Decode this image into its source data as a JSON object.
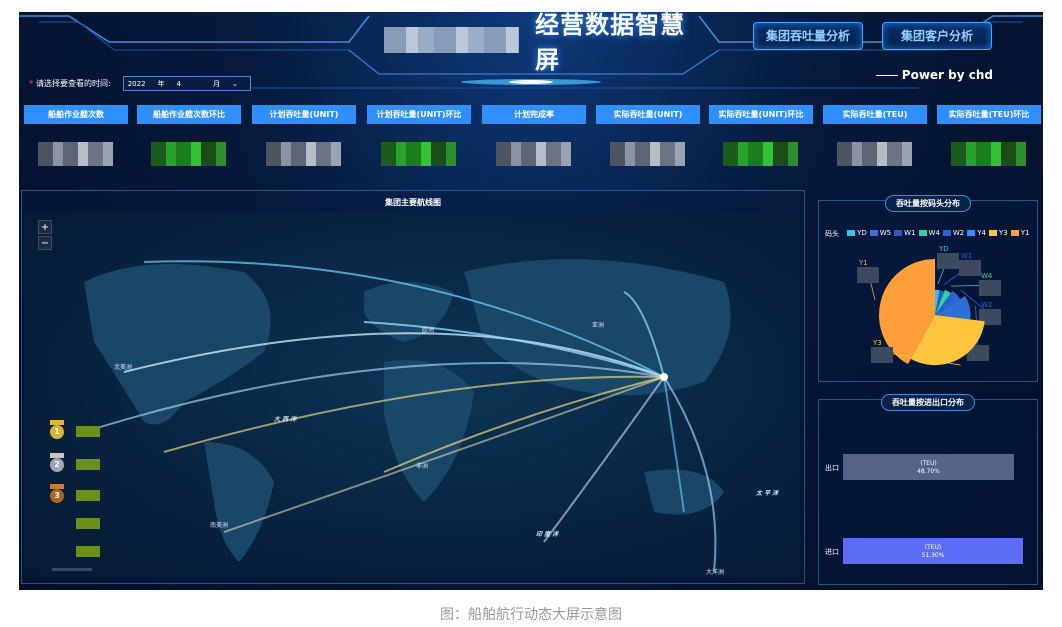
{
  "header": {
    "title": "经营数据智慧屏",
    "buttons": [
      "集团吞吐量分析",
      "集团客户分析"
    ],
    "powered_by": "Power by chd"
  },
  "date_filter": {
    "label": "请选择要查看的时间:",
    "year": "2022",
    "year_unit": "年",
    "month": "4",
    "month_unit": "月"
  },
  "kpis": [
    {
      "label": "船舶作业艘次数",
      "tone": "gray"
    },
    {
      "label": "船舶作业艘次数环比",
      "tone": "green"
    },
    {
      "label": "计划吞吐量(UNIT)",
      "tone": "gray"
    },
    {
      "label": "计划吞吐量(UNIT)环比",
      "tone": "green"
    },
    {
      "label": "计划完成率",
      "tone": "gray"
    },
    {
      "label": "实际吞吐量(UNIT)",
      "tone": "gray"
    },
    {
      "label": "实际吞吐量(UNIT)环比",
      "tone": "green"
    },
    {
      "label": "实际吞吐量(TEU)",
      "tone": "gray"
    },
    {
      "label": "实际吞吐量(TEU)环比",
      "tone": "green"
    }
  ],
  "map_panel": {
    "title": "集团主要航线图",
    "zoom_in": "+",
    "zoom_out": "−",
    "labels": [
      "北美洲",
      "欧洲",
      "亚洲",
      "非洲",
      "南美洲",
      "大洋洲"
    ],
    "oceans": [
      "大 西 洋",
      "印 度 洋",
      "太 平 洋"
    ],
    "ranks": [
      "1",
      "2",
      "3",
      "",
      ""
    ]
  },
  "pie_panel": {
    "title": "吞吐量按码头分布",
    "legend_title": "码头",
    "legend": [
      {
        "name": "YD",
        "color": "#37c2e6"
      },
      {
        "name": "W5",
        "color": "#3c6fd8"
      },
      {
        "name": "W1",
        "color": "#3257c9"
      },
      {
        "name": "W4",
        "color": "#2ed3a3"
      },
      {
        "name": "W2",
        "color": "#2a62d8"
      },
      {
        "name": "Y4",
        "color": "#2f8fff"
      },
      {
        "name": "Y3",
        "color": "#ffc53d"
      },
      {
        "name": "Y1",
        "color": "#ff9f3a"
      }
    ],
    "slices": [
      {
        "name": "Y1",
        "value": 42,
        "color": "#ff9f3a"
      },
      {
        "name": "YD",
        "value": 3,
        "color": "#37c2e6"
      },
      {
        "name": "W1",
        "value": 3,
        "color": "#3257c9"
      },
      {
        "name": "W4",
        "value": 4,
        "color": "#2ed3a3"
      },
      {
        "name": "W2",
        "value": 6,
        "color": "#2a62d8"
      },
      {
        "name": "Y4",
        "value": 11,
        "color": "#2f6fd8"
      },
      {
        "name": "Y3",
        "value": 31,
        "color": "#ffc53d"
      }
    ]
  },
  "io_panel": {
    "title": "吞吐量按进出口分布",
    "rows": [
      {
        "label": "出口",
        "unit": "(TEU)",
        "percent": "48.70%",
        "share": 48.7,
        "color": "#55638a"
      },
      {
        "label": "进口",
        "unit": "(TEU)",
        "percent": "51.30%",
        "share": 51.3,
        "color": "#5b6cf6"
      }
    ]
  },
  "caption": "图：船舶航行动态大屏示意图"
}
